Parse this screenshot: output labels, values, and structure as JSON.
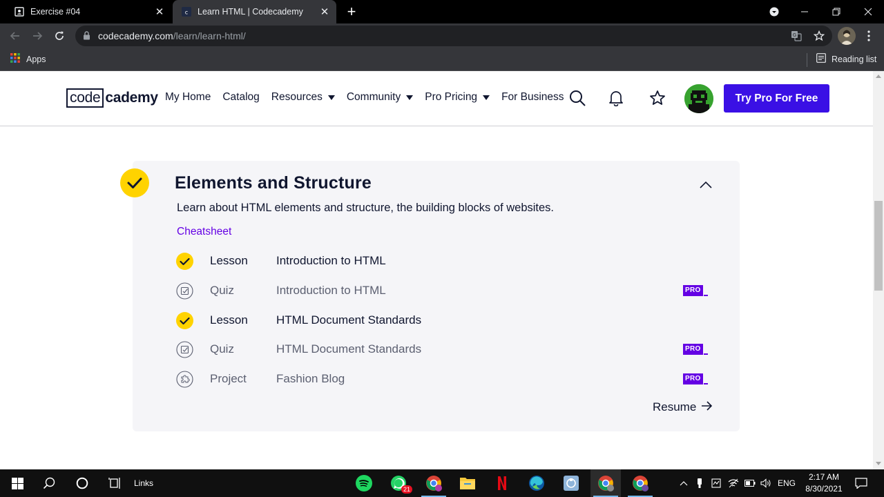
{
  "browser": {
    "tabs": [
      {
        "title": "Exercise #04",
        "active": false
      },
      {
        "title": "Learn HTML | Codecademy",
        "active": true
      }
    ],
    "url": {
      "host": "codecademy.com",
      "path": "/learn/learn-html/"
    },
    "bookmarks": {
      "apps": "Apps",
      "reading_list": "Reading list"
    }
  },
  "site": {
    "logo": {
      "boxed": "code",
      "rest": "cademy"
    },
    "nav": {
      "my_home": "My Home",
      "catalog": "Catalog",
      "resources": "Resources",
      "community": "Community",
      "pro_pricing": "Pro Pricing",
      "for_business": "For Business"
    },
    "cta": "Try Pro For Free"
  },
  "module": {
    "title": "Elements and Structure",
    "description": "Learn about HTML elements and structure, the building blocks of websites.",
    "cheatsheet": "Cheatsheet",
    "items": [
      {
        "type": "Lesson",
        "name": "Introduction to HTML",
        "completed": true,
        "pro": false
      },
      {
        "type": "Quiz",
        "name": "Introduction to HTML",
        "completed": false,
        "pro": true
      },
      {
        "type": "Lesson",
        "name": "HTML Document Standards",
        "completed": true,
        "pro": false
      },
      {
        "type": "Quiz",
        "name": "HTML Document Standards",
        "completed": false,
        "pro": true
      },
      {
        "type": "Project",
        "name": "Fashion Blog",
        "completed": false,
        "pro": true
      }
    ],
    "pro_badge": "PRO",
    "resume": "Resume"
  },
  "taskbar": {
    "links": "Links",
    "whatsapp_badge": "21",
    "language": "ENG",
    "time": "2:17 AM",
    "date": "8/30/2021"
  },
  "colors": {
    "accent": "#3a10e5",
    "pro": "#6400e4",
    "check": "#ffd300",
    "navy": "#10162f"
  }
}
